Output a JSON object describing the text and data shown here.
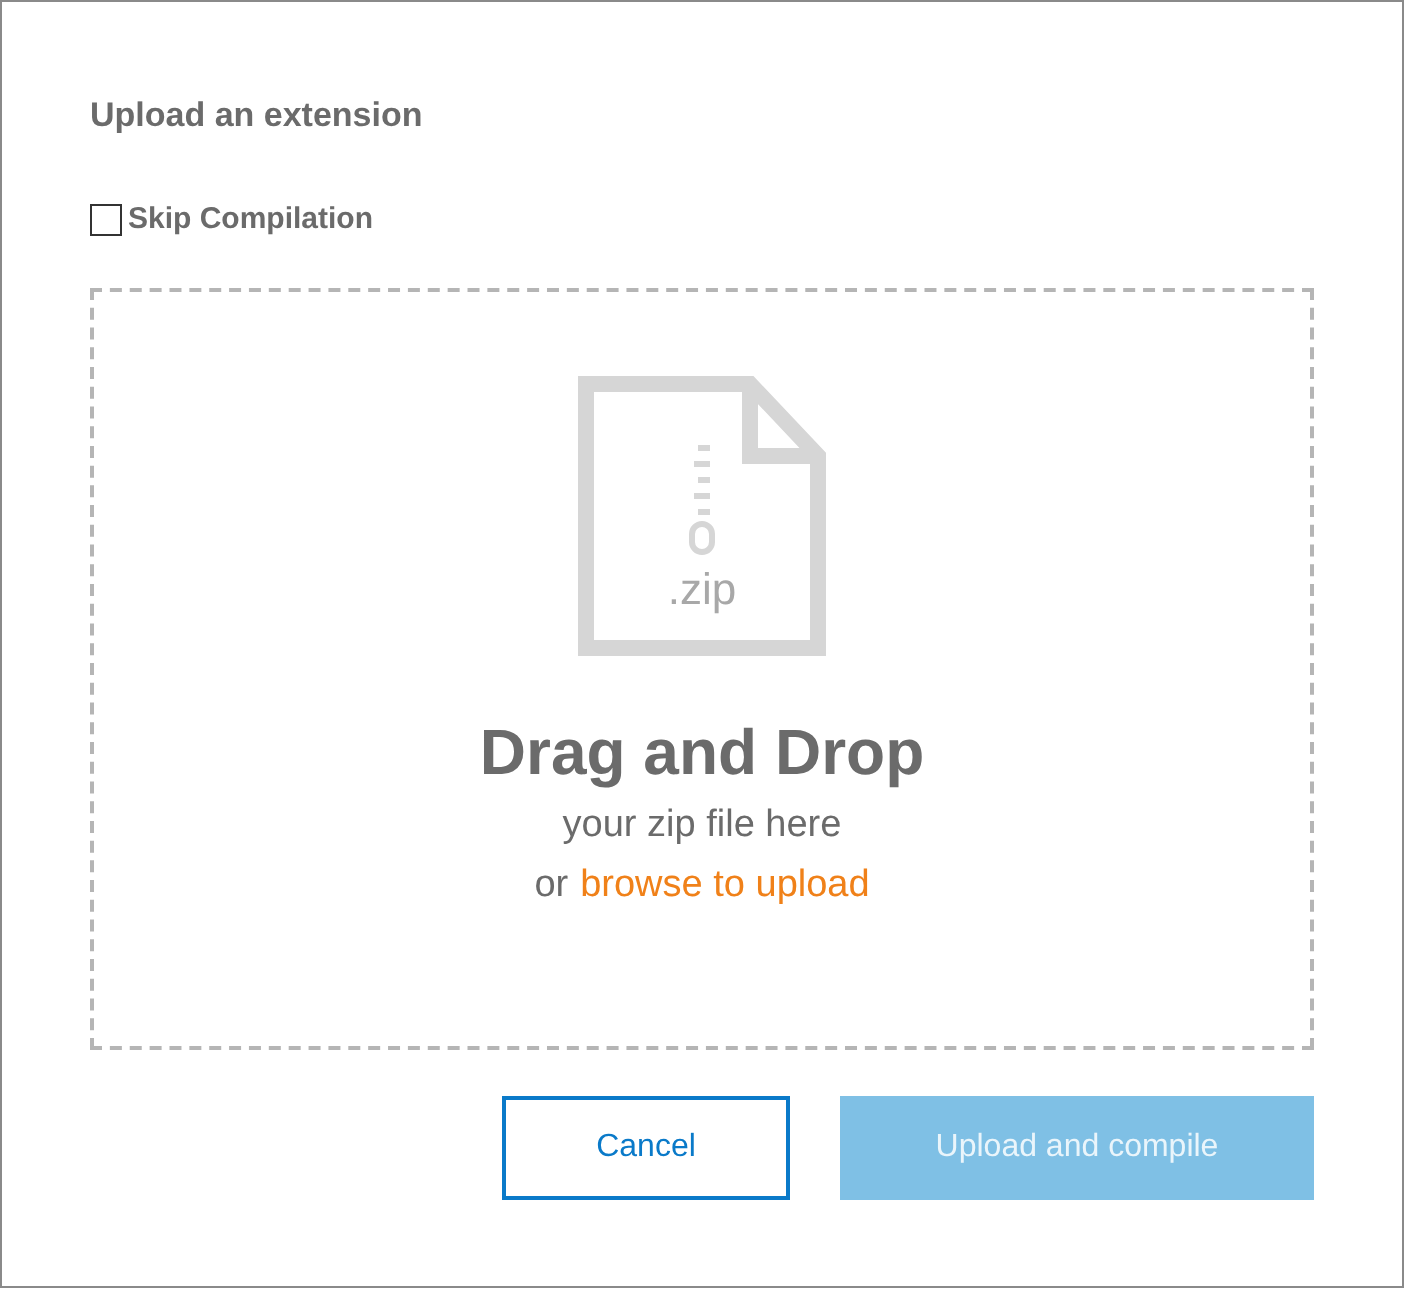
{
  "dialog": {
    "title": "Upload an extension"
  },
  "skip_compilation": {
    "label": "Skip Compilation",
    "checked": false
  },
  "dropzone": {
    "icon_label": ".zip",
    "heading": "Drag and Drop",
    "line": "your zip file here",
    "prefix": "or",
    "link": "browse to upload"
  },
  "buttons": [
    {
      "kind": "secondary",
      "label": "Cancel",
      "disabled": false
    },
    {
      "kind": "primary",
      "label": "Upload and compile",
      "disabled": true
    }
  ]
}
